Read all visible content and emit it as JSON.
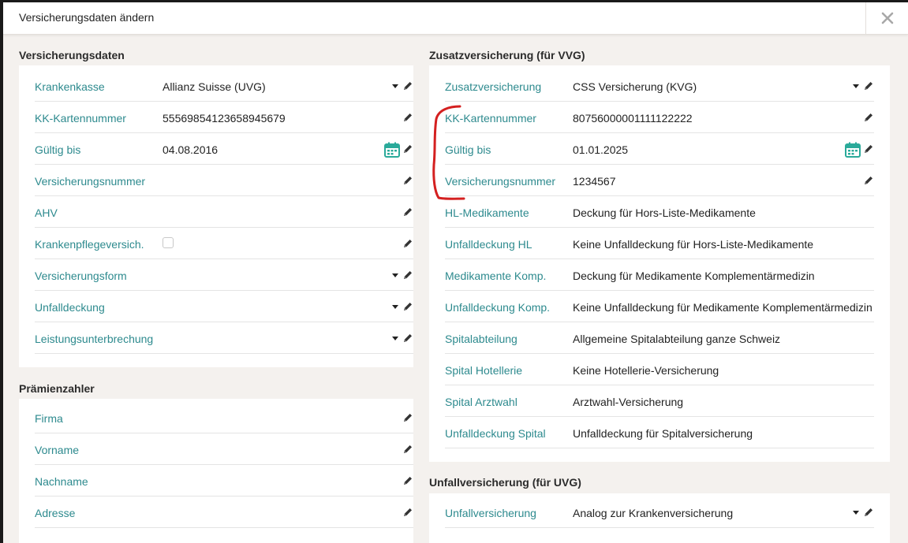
{
  "dialog": {
    "title": "Versicherungsdaten ändern",
    "close_label": "✕"
  },
  "versicherungsdaten": {
    "title": "Versicherungsdaten",
    "rows": [
      {
        "label": "Krankenkasse",
        "value": "Allianz Suisse (UVG)",
        "kind": "select"
      },
      {
        "label": "KK-Kartennummer",
        "value": "55569854123658945679",
        "kind": "text"
      },
      {
        "label": "Gültig bis",
        "value": "04.08.2016",
        "kind": "date"
      },
      {
        "label": "Versicherungsnummer",
        "value": "",
        "kind": "text"
      },
      {
        "label": "AHV",
        "value": "",
        "kind": "text"
      },
      {
        "label": "Krankenpflegeversich.",
        "value": "",
        "kind": "checkbox"
      },
      {
        "label": "Versicherungsform",
        "value": "",
        "kind": "select"
      },
      {
        "label": "Unfalldeckung",
        "value": "",
        "kind": "select"
      },
      {
        "label": "Leistungsunterbrechung",
        "value": "",
        "kind": "select"
      }
    ]
  },
  "praemienzahler": {
    "title": "Prämienzahler",
    "rows": [
      {
        "label": "Firma",
        "value": "",
        "kind": "text"
      },
      {
        "label": "Vorname",
        "value": "",
        "kind": "text"
      },
      {
        "label": "Nachname",
        "value": "",
        "kind": "text"
      },
      {
        "label": "Adresse",
        "value": "",
        "kind": "text"
      }
    ]
  },
  "zusatzversicherung": {
    "title": "Zusatzversicherung (für VVG)",
    "rows": [
      {
        "label": "Zusatzversicherung",
        "value": "CSS Versicherung (KVG)",
        "kind": "select"
      },
      {
        "label": "KK-Kartennummer",
        "value": "80756000001111122222",
        "kind": "text"
      },
      {
        "label": "Gültig bis",
        "value": "01.01.2025",
        "kind": "date"
      },
      {
        "label": "Versicherungsnummer",
        "value": "1234567",
        "kind": "text"
      },
      {
        "label": "HL-Medikamente",
        "value": "Deckung für Hors-Liste-Medikamente",
        "kind": "static"
      },
      {
        "label": "Unfalldeckung HL",
        "value": "Keine Unfalldeckung für Hors-Liste-Medikamente",
        "kind": "static"
      },
      {
        "label": "Medikamente Komp.",
        "value": "Deckung für Medikamente Komplementärmedizin",
        "kind": "static"
      },
      {
        "label": "Unfalldeckung Komp.",
        "value": "Keine Unfalldeckung für Medikamente Komplementärmedizin",
        "kind": "static"
      },
      {
        "label": "Spitalabteilung",
        "value": "Allgemeine Spitalabteilung ganze Schweiz",
        "kind": "static"
      },
      {
        "label": "Spital Hotellerie",
        "value": "Keine Hotellerie-Versicherung",
        "kind": "static"
      },
      {
        "label": "Spital Arztwahl",
        "value": "Arztwahl-Versicherung",
        "kind": "static"
      },
      {
        "label": "Unfalldeckung Spital",
        "value": "Unfalldeckung für Spitalversicherung",
        "kind": "static"
      }
    ]
  },
  "unfallversicherung": {
    "title": "Unfallversicherung (für UVG)",
    "rows": [
      {
        "label": "Unfallversicherung",
        "value": "Analog zur Krankenversicherung",
        "kind": "select"
      }
    ]
  },
  "colors": {
    "label": "#2d8a8e",
    "calendar": "#2aaa9a",
    "annotation": "#d42020"
  },
  "icons": {
    "edit": "pencil-icon",
    "calendar": "calendar-icon",
    "dropdown": "caret-down-icon",
    "close": "close-icon"
  }
}
